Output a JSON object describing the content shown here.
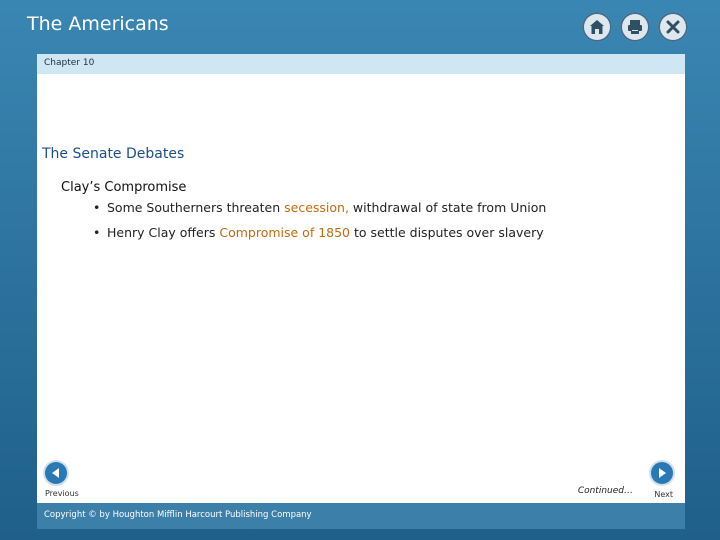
{
  "window": {
    "title": "The Americans",
    "icons": [
      "home-icon",
      "print-icon",
      "close-icon"
    ]
  },
  "chapter_bar": {
    "label": "Chapter 10"
  },
  "slide": {
    "heading": "The Senate Debates",
    "subheading": "Clay’s Compromise",
    "bullets": [
      {
        "before": "Some Southerners threaten ",
        "highlight": "secession,",
        "after": " withdrawal of state from Union"
      },
      {
        "before": "Henry Clay offers ",
        "highlight": "Compromise of 1850",
        "after": " to settle disputes over slavery"
      }
    ],
    "continued_label": "Continued…"
  },
  "navigation": {
    "previous_label": "Previous",
    "next_label": "Next"
  },
  "footer": {
    "copyright": "Copyright © by Houghton Mifflin Harcourt Publishing Company"
  },
  "colors": {
    "frame": "#2b6f9a",
    "chapter_bar": "#cfe7f3",
    "heading": "#1a4f88",
    "highlight": "#c36a12",
    "footer": "#3c7fa9"
  }
}
